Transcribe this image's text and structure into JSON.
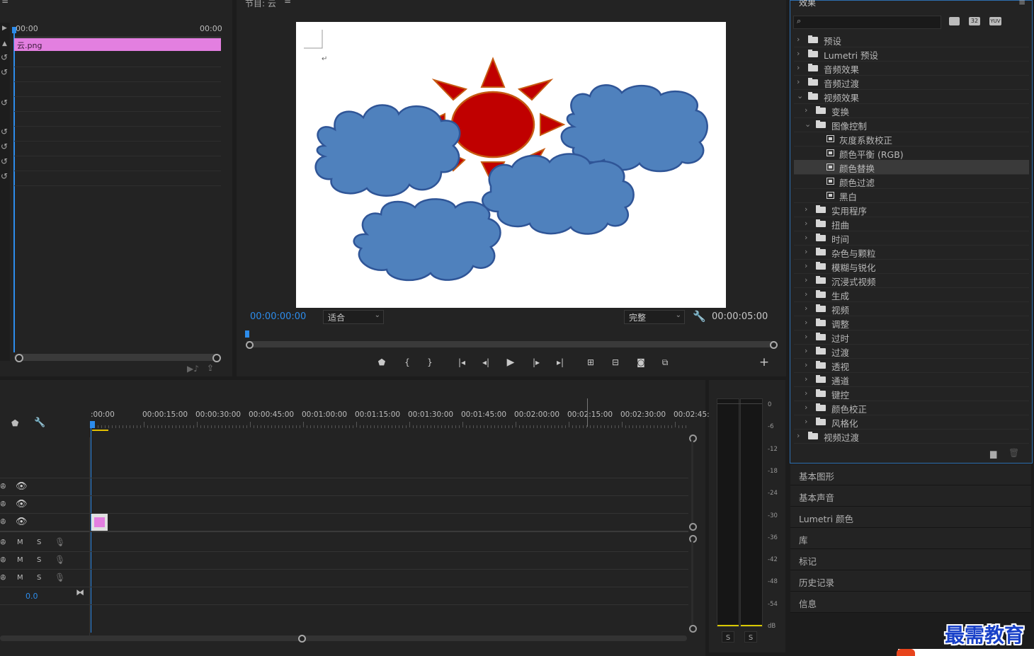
{
  "source_panel": {
    "time_start": "00:00",
    "time_end": "00:00",
    "clip_label": "云.png"
  },
  "program": {
    "title": "节目: 云",
    "timecode_current": "00:00:00:00",
    "fit_select": "适合",
    "quality_select": "完整",
    "timecode_duration": "00:00:05:00"
  },
  "timeline": {
    "ruler_labels": [
      ":00:00",
      "00:00:15:00",
      "00:00:30:00",
      "00:00:45:00",
      "00:01:00:00",
      "00:01:15:00",
      "00:01:30:00",
      "00:01:45:00",
      "00:02:00:00",
      "00:02:15:00",
      "00:02:30:00",
      "00:02:45:"
    ],
    "audio_tracks": [
      {
        "m": "M",
        "s": "S"
      },
      {
        "m": "M",
        "s": "S"
      },
      {
        "m": "M",
        "s": "S"
      }
    ],
    "master_level": "0.0"
  },
  "meter": {
    "scale": [
      "0",
      "-6",
      "-12",
      "-18",
      "-24",
      "-30",
      "-36",
      "-42",
      "-48",
      "-54",
      "dB"
    ],
    "solo_left": "S",
    "solo_right": "S"
  },
  "effects": {
    "title": "效果",
    "search_placeholder": "",
    "badges": [
      "32",
      "YUV"
    ],
    "items": [
      {
        "label": "预设",
        "level": 0,
        "expanded": false,
        "kind": "preset-folder"
      },
      {
        "label": "Lumetri 预设",
        "level": 0,
        "expanded": false,
        "kind": "preset-folder"
      },
      {
        "label": "音频效果",
        "level": 0,
        "expanded": false,
        "kind": "folder"
      },
      {
        "label": "音频过渡",
        "level": 0,
        "expanded": false,
        "kind": "folder"
      },
      {
        "label": "视频效果",
        "level": 0,
        "expanded": true,
        "kind": "folder"
      },
      {
        "label": "变换",
        "level": 1,
        "expanded": false,
        "kind": "folder"
      },
      {
        "label": "图像控制",
        "level": 1,
        "expanded": true,
        "kind": "folder"
      },
      {
        "label": "灰度系数校正",
        "level": 2,
        "kind": "effect"
      },
      {
        "label": "颜色平衡 (RGB)",
        "level": 2,
        "kind": "effect"
      },
      {
        "label": "颜色替换",
        "level": 2,
        "kind": "effect",
        "selected": true
      },
      {
        "label": "颜色过滤",
        "level": 2,
        "kind": "effect"
      },
      {
        "label": "黑白",
        "level": 2,
        "kind": "effect"
      },
      {
        "label": "实用程序",
        "level": 1,
        "expanded": false,
        "kind": "folder"
      },
      {
        "label": "扭曲",
        "level": 1,
        "expanded": false,
        "kind": "folder"
      },
      {
        "label": "时间",
        "level": 1,
        "expanded": false,
        "kind": "folder"
      },
      {
        "label": "杂色与颗粒",
        "level": 1,
        "expanded": false,
        "kind": "folder"
      },
      {
        "label": "模糊与锐化",
        "level": 1,
        "expanded": false,
        "kind": "folder"
      },
      {
        "label": "沉浸式视频",
        "level": 1,
        "expanded": false,
        "kind": "folder"
      },
      {
        "label": "生成",
        "level": 1,
        "expanded": false,
        "kind": "folder"
      },
      {
        "label": "视频",
        "level": 1,
        "expanded": false,
        "kind": "folder"
      },
      {
        "label": "调整",
        "level": 1,
        "expanded": false,
        "kind": "folder"
      },
      {
        "label": "过时",
        "level": 1,
        "expanded": false,
        "kind": "folder"
      },
      {
        "label": "过渡",
        "level": 1,
        "expanded": false,
        "kind": "folder"
      },
      {
        "label": "透视",
        "level": 1,
        "expanded": false,
        "kind": "folder"
      },
      {
        "label": "通道",
        "level": 1,
        "expanded": false,
        "kind": "folder"
      },
      {
        "label": "键控",
        "level": 1,
        "expanded": false,
        "kind": "folder"
      },
      {
        "label": "颜色校正",
        "level": 1,
        "expanded": false,
        "kind": "folder"
      },
      {
        "label": "风格化",
        "level": 1,
        "expanded": false,
        "kind": "folder"
      },
      {
        "label": "视频过渡",
        "level": 0,
        "expanded": false,
        "kind": "folder"
      }
    ]
  },
  "side_panels": [
    "基本图形",
    "基本声音",
    "Lumetri 颜色",
    "库",
    "标记",
    "历史记录",
    "信息"
  ],
  "watermark": "最需教育",
  "colors": {
    "accent_blue": "#2d8ceb",
    "clip_pink": "#e37fe0",
    "sun_red": "#c00000",
    "cloud_blue": "#4f81bd",
    "cloud_border": "#2f5597"
  }
}
